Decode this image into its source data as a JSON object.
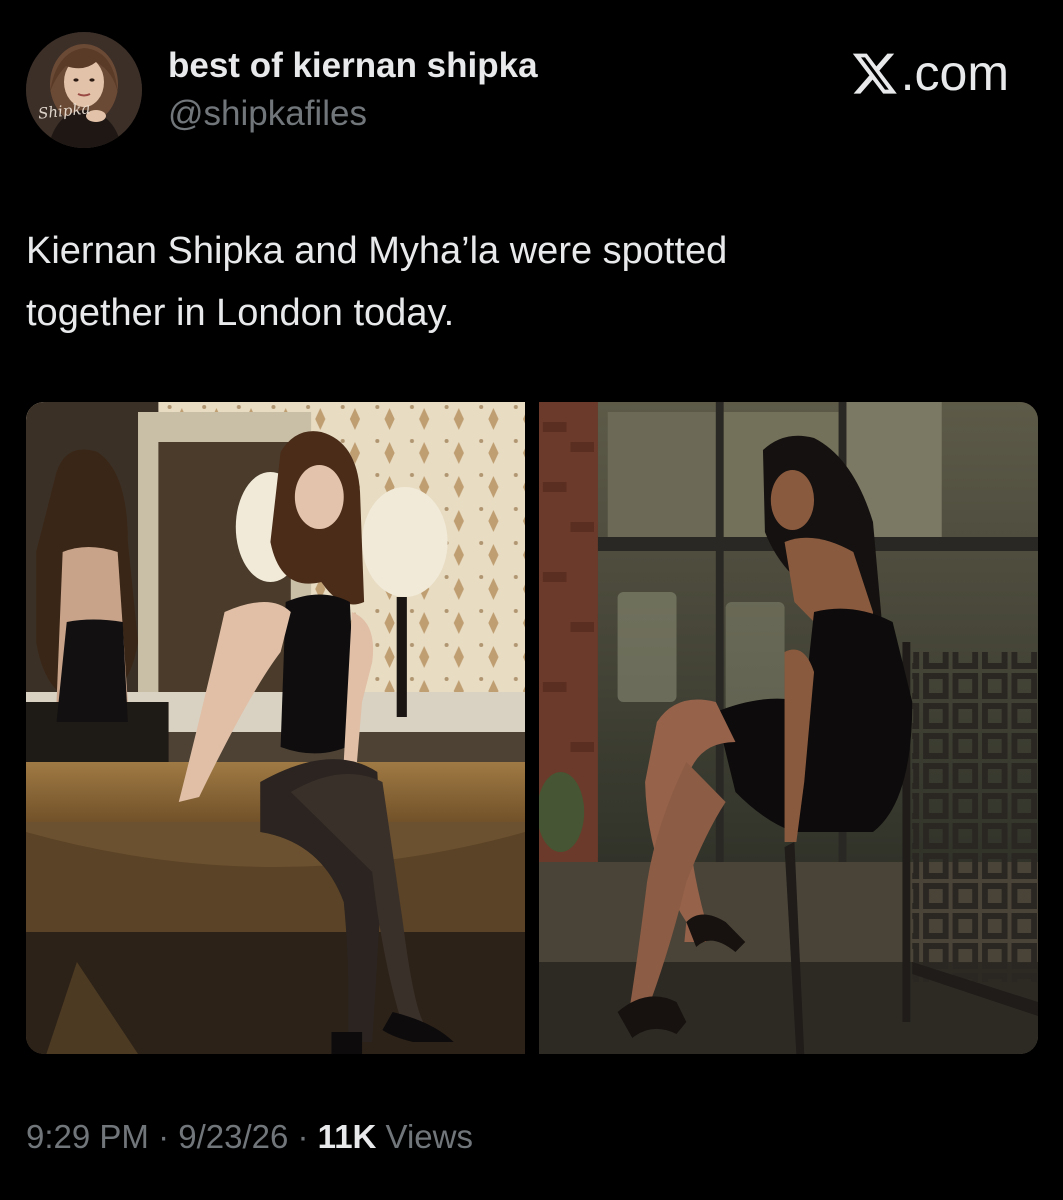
{
  "author": {
    "display_name": "best of kiernan shipka",
    "handle": "@shipkafiles",
    "avatar_signature": "Shipka"
  },
  "brand": {
    "label": ".com",
    "logo": "x-logo-icon"
  },
  "tweet": {
    "line1": "Kiernan Shipka and Myha’la were spotted",
    "line2": "together in London today."
  },
  "media": [
    {
      "name": "photo-kiernan-shipka",
      "icon": "photo"
    },
    {
      "name": "photo-myhala",
      "icon": "photo"
    }
  ],
  "meta": {
    "time": "9:29 PM",
    "sep1": " · ",
    "date": "9/23/26",
    "sep2": " · ",
    "views_count": "11K",
    "views_label": " Views"
  },
  "colors": {
    "background": "#000000",
    "text_primary": "#e7e9ea",
    "text_secondary": "#71767b"
  }
}
